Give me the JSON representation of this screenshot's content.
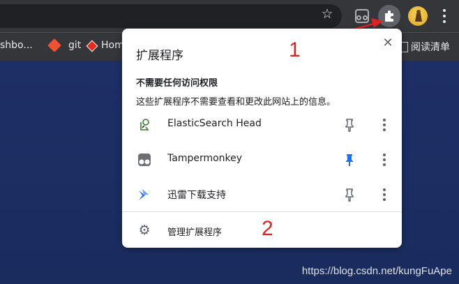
{
  "bookmarks": {
    "items": [
      {
        "label": "shbo..."
      },
      {
        "label": "git"
      },
      {
        "label": "Hom"
      },
      {
        "label": "阅读清单"
      }
    ]
  },
  "popup": {
    "title": "扩展程序",
    "close_label": "✕",
    "section": {
      "heading": "不需要任何访问权限",
      "description": "这些扩展程序不需要查看和更改此网站上的信息。"
    },
    "extensions": [
      {
        "name": "ElasticSearch Head",
        "pinned": false
      },
      {
        "name": "Tampermonkey",
        "pinned": true
      },
      {
        "name": "迅雷下载支持",
        "pinned": false
      }
    ],
    "manage_label": "管理扩展程序"
  },
  "annotations": {
    "step1": "1",
    "step2": "2"
  },
  "watermark": "https://blog.csdn.net/kungFuApe",
  "colors": {
    "toolbar": "#35363a",
    "page_background": "#1d2f63",
    "annotation_red": "#e02121",
    "pin_active": "#1a73e8",
    "pin_inactive": "#5f6368"
  },
  "icons": {
    "star": "star-icon",
    "puzzle": "puzzle-icon",
    "gear": "gear-icon",
    "pin": "pin-icon"
  }
}
